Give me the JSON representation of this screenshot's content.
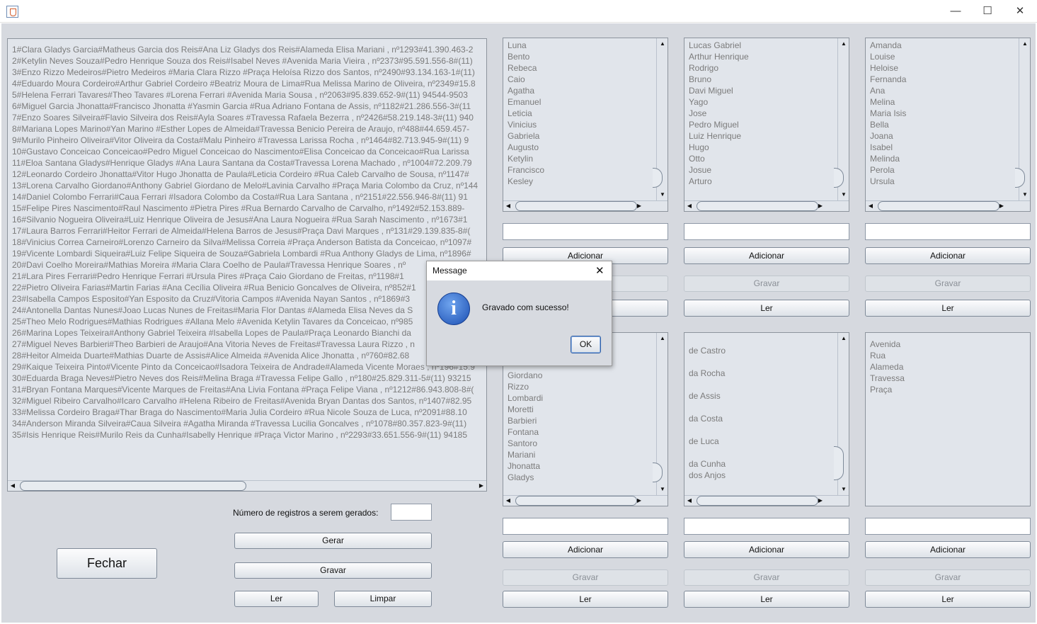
{
  "window": {
    "minimize": "—",
    "maximize": "☐",
    "close": "✕"
  },
  "records": [
    "1#Clara Gladys Garcia#Matheus Garcia dos Reis#Ana Liz Gladys dos Reis#Alameda Elisa Mariani  , nº1293#41.390.463-2",
    "2#Ketylin Neves Souza#Pedro Henrique Souza dos Reis#Isabel Neves  #Avenida Maria Vieira  , nº2373#95.591.556-8#(11)",
    "3#Enzo Rizzo Medeiros#Pietro Medeiros  #Maria Clara Rizzo  #Praça Heloísa Rizzo dos Santos, nº2490#93.134.163-1#(11)",
    "4#Eduardo Moura Cordeiro#Arthur Gabriel Cordeiro  #Beatriz Moura de Lima#Rua Melissa Marino de Oliveira, nº2349#15.8",
    "5#Helena Ferrari Tavares#Theo Tavares  #Lorena Ferrari  #Avenida Maria Sousa  , nº2063#95.839.652-9#(11) 94544-9503",
    "6#Miguel Garcia Jhonatta#Francisco Jhonatta  #Yasmin Garcia  #Rua Adriano Fontana de Assis, nº1182#21.286.556-3#(11",
    "7#Enzo Soares Silveira#Flavio Silveira dos Reis#Ayla Soares  #Travessa Rafaela Bezerra  , nº2426#58.219.148-3#(11) 940",
    "8#Mariana Lopes Marino#Yan Marino  #Esther Lopes de Almeida#Travessa Benicio Pereira de Araujo, nº488#44.659.457-",
    "9#Murilo Pinheiro Oliveira#Vitor Oliveira da Costa#Malu Pinheiro  #Travessa Larissa Rocha  , nº1464#82.713.945-9#(11) 9",
    "10#Gustavo Conceicao Conceicao#Pedro Miguel Conceicao do Nascimento#Elisa Conceicao da Conceicao#Rua Larissa",
    "11#Eloa Santana Gladys#Henrique Gladys  #Ana Laura Santana da Costa#Travessa Lorena Machado  , nº1004#72.209.79",
    "12#Leonardo Cordeiro Jhonatta#Vitor Hugo Jhonatta de Paula#Leticia Cordeiro  #Rua Caleb Carvalho de Sousa, nº1147#",
    "13#Lorena Carvalho Giordano#Anthony Gabriel Giordano de Melo#Lavinia Carvalho  #Praça Maria Colombo da Cruz, nº144",
    "14#Daniel Colombo Ferrari#Caua Ferrari  #Isadora Colombo da Costa#Rua Lara Santana  , nº2151#22.556.946-8#(11) 91",
    "15#Felipe Pires Nascimento#Raul Nascimento  #Pietra Pires  #Rua Bernardo Carvalho de Carvalho, nº1492#52.153.889-",
    "16#Silvanio Nogueira Oliveira#Luiz Henrique Oliveira de Jesus#Ana Laura Nogueira  #Rua Sarah Nascimento  , nº1673#1",
    "17#Laura Barros Ferrari#Heitor Ferrari de Almeida#Helena Barros de Jesus#Praça Davi Marques  , nº131#29.139.835-8#(",
    "18#Vinicius Correa Carneiro#Lorenzo Carneiro da Silva#Melissa Correia  #Praça Anderson Batista da Conceicao, nº1097#",
    "19#Vicente Lombardi Siqueira#Luiz Felipe Siqueira de Souza#Gabriela Lombardi  #Rua Anthony Gladys de Lima, nº1896#",
    "20#Davi Coelho Moreira#Mathias Moreira  #Maria Clara Coelho de Paula#Travessa Henrique Soares  , nº",
    "21#Lara Pires Ferrari#Pedro Henrique Ferrari  #Ursula Pires  #Praça Caio Giordano de Freitas, nº1198#1",
    "22#Pietro Oliveira Farias#Martin Farias  #Ana Cecília Oliveira  #Rua Benicio Goncalves de Oliveira, nº852#1",
    "23#Isabella Campos Esposito#Yan Esposito da Cruz#Vitoria Campos  #Avenida Nayan Santos  , nº1869#3",
    "24#Antonella Dantas Nunes#Joao Lucas Nunes de Freitas#Maria Flor Dantas  #Alameda Elisa Neves da S",
    "25#Theo Melo Rodrigues#Mathias Rodrigues  #Allana Melo  #Avenida Ketylin Tavares da Conceicao, nº985",
    "26#Marina Lopes Teixeira#Anthony Gabriel Teixeira  #Isabella Lopes de Paula#Praça Leonardo Bianchi da",
    "27#Miguel Neves Barbieri#Theo Barbieri de Araujo#Ana Vitoria Neves de Freitas#Travessa Laura Rizzo  , n",
    "28#Heitor Almeida Duarte#Mathias Duarte de Assis#Alice Almeida  #Avenida Alice Jhonatta  , nº760#82.68",
    "29#Kaique Teixeira Pinto#Vicente Pinto da Conceicao#Isadora Teixeira de Andrade#Alameda Vicente Moraes  , nº196#15.9",
    "30#Eduarda Braga Neves#Pietro Neves dos Reis#Melina Braga  #Travessa Felipe Gallo  , nº180#25.829.311-5#(11) 93215",
    "31#Bryan Fontana Marques#Vicente Marques de Freitas#Ana Livia Fontana  #Praça Felipe Viana  , nº1212#86.943.808-8#(",
    "32#Miguel Ribeiro Carvalho#Icaro Carvalho  #Helena Ribeiro de Freitas#Avenida Bryan Dantas dos Santos, nº1407#82.95",
    "33#Melissa Cordeiro Braga#Thar Braga do Nascimento#Maria Julia Cordeiro  #Rua Nicole Souza de Luca, nº2091#88.10",
    "34#Anderson Miranda Silveira#Caua Silveira  #Agatha Miranda  #Travessa Lucilia Goncalves  , nº1078#80.357.823-9#(11)",
    "35#Isis Henrique Reis#Murilo Reis da Cunha#Isabelly Henrique  #Praça Victor Marino  , nº2293#33.651.556-9#(11) 94185"
  ],
  "generator": {
    "label": "Número de registros a serem gerados:",
    "count": "",
    "gerar": "Gerar",
    "gravar": "Gravar",
    "ler": "Ler",
    "limpar": "Limpar",
    "fechar": "Fechar"
  },
  "panels": [
    {
      "items": [
        "Luna",
        "Bento",
        "Rebeca",
        "Caio",
        "Agatha",
        "Emanuel",
        "Leticia",
        "Vinicius",
        "Gabriela",
        "Augusto",
        "Ketylin",
        "Francisco",
        "Kesley"
      ],
      "input": "",
      "adicionar": "Adicionar",
      "gravar": "Gravar",
      "ler": "Ler"
    },
    {
      "items": [
        "Lucas Gabriel",
        "Arthur Henrique",
        "Rodrigo",
        "Bruno",
        "Davi Miguel",
        "Yago",
        "Jose",
        "Pedro Miguel",
        "Luiz Henrique",
        "Hugo",
        "Otto",
        "Josue",
        "Arturo"
      ],
      "input": "",
      "adicionar": "Adicionar",
      "gravar": "Gravar",
      "ler": "Ler"
    },
    {
      "items": [
        "Amanda",
        "Louise",
        "Heloise",
        "Fernanda",
        "Ana",
        "Melina",
        "Maria Isis",
        "Bella",
        "Joana",
        "Isabel",
        "Melinda",
        "Perola",
        "Ursula"
      ],
      "input": "",
      "adicionar": "Adicionar",
      "gravar": "Gravar",
      "ler": "Ler"
    },
    {
      "items": [
        "Giordano",
        "Rizzo",
        "Lombardi",
        "Moretti",
        "Barbieri",
        "Fontana",
        "Santoro",
        "Mariani",
        "Jhonatta",
        "Gladys"
      ],
      "input": "",
      "adicionar": "Adicionar",
      "gravar": "Gravar",
      "ler": "Ler"
    },
    {
      "items": [
        "de Castro",
        "",
        "da Rocha",
        "",
        "de Assis",
        "",
        "da Costa",
        "",
        "de Luca",
        "",
        "da Cunha",
        "dos Anjos"
      ],
      "input": "",
      "adicionar": "Adicionar",
      "gravar": "Gravar",
      "ler": "Ler"
    },
    {
      "items": [
        "Avenida",
        "Rua",
        "Alameda",
        "Travessa",
        "Praça"
      ],
      "input": "",
      "adicionar": "Adicionar",
      "gravar": "Gravar",
      "ler": "Ler"
    }
  ],
  "dialog": {
    "title": "Message",
    "close": "✕",
    "icon": "info-icon",
    "message": "Gravado com sucesso!",
    "ok": "OK"
  }
}
